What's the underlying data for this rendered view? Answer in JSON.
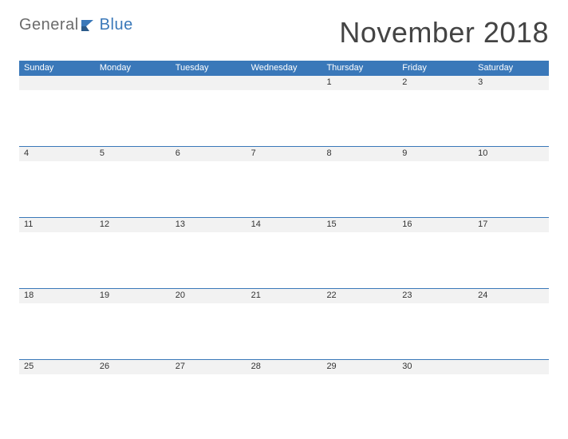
{
  "logo": {
    "word1": "General",
    "word2": "Blue"
  },
  "title": "November 2018",
  "day_headers": [
    "Sunday",
    "Monday",
    "Tuesday",
    "Wednesday",
    "Thursday",
    "Friday",
    "Saturday"
  ],
  "weeks": [
    [
      "",
      "",
      "",
      "",
      "1",
      "2",
      "3"
    ],
    [
      "4",
      "5",
      "6",
      "7",
      "8",
      "9",
      "10"
    ],
    [
      "11",
      "12",
      "13",
      "14",
      "15",
      "16",
      "17"
    ],
    [
      "18",
      "19",
      "20",
      "21",
      "22",
      "23",
      "24"
    ],
    [
      "25",
      "26",
      "27",
      "28",
      "29",
      "30",
      ""
    ]
  ]
}
